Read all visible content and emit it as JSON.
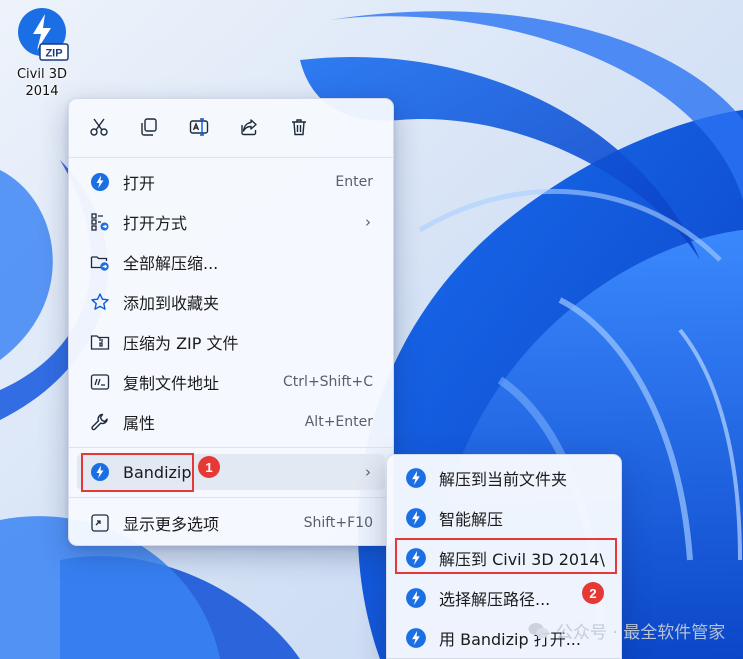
{
  "desktop_icon": {
    "label": "Civil 3D\n2014",
    "badge_text": "ZIP"
  },
  "toolbar": [
    {
      "name": "cut-icon"
    },
    {
      "name": "copy-icon"
    },
    {
      "name": "rename-icon"
    },
    {
      "name": "share-icon"
    },
    {
      "name": "delete-icon"
    }
  ],
  "menu": {
    "open": {
      "label": "打开",
      "shortcut": "Enter"
    },
    "open_with": {
      "label": "打开方式"
    },
    "extract_all": {
      "label": "全部解压缩..."
    },
    "add_favorite": {
      "label": "添加到收藏夹"
    },
    "compress_zip": {
      "label": "压缩为 ZIP 文件"
    },
    "copy_path": {
      "label": "复制文件地址",
      "shortcut": "Ctrl+Shift+C"
    },
    "properties": {
      "label": "属性",
      "shortcut": "Alt+Enter"
    },
    "bandizip": {
      "label": "Bandizip"
    },
    "more_options": {
      "label": "显示更多选项",
      "shortcut": "Shift+F10"
    }
  },
  "submenu": {
    "items": [
      {
        "label": "解压到当前文件夹"
      },
      {
        "label": "智能解压"
      },
      {
        "label": "解压到 Civil 3D 2014\\"
      },
      {
        "label": "选择解压路径..."
      },
      {
        "label": "用 Bandizip 打开..."
      }
    ]
  },
  "annotations": {
    "badge_1": "1",
    "badge_2": "2"
  },
  "watermark": {
    "text": "公众号 · 最全软件管家"
  },
  "colors": {
    "accent": "#0b5cd6",
    "annotation_red": "#e53935",
    "menu_bg": "#f6f9fe"
  }
}
